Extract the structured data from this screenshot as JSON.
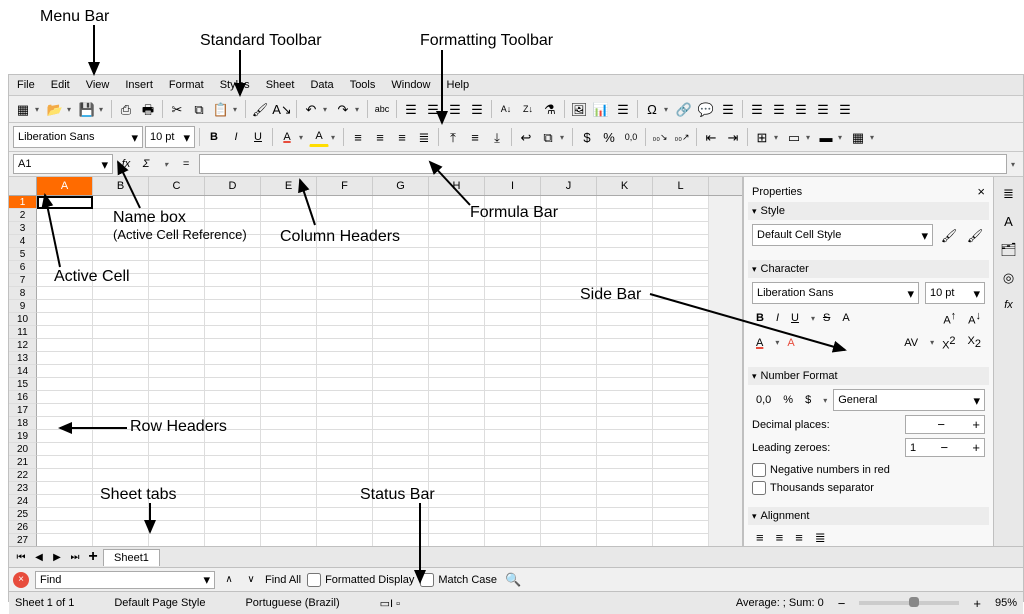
{
  "annotations": {
    "menu_bar": "Menu Bar",
    "standard_toolbar": "Standard Toolbar",
    "formatting_toolbar": "Formatting Toolbar",
    "name_box": "Name box",
    "name_box_sub": "(Active Cell Reference)",
    "active_cell": "Active Cell",
    "column_headers": "Column Headers",
    "formula_bar": "Formula Bar",
    "side_bar": "Side Bar",
    "row_headers": "Row Headers",
    "sheet_tabs": "Sheet tabs",
    "status_bar": "Status Bar"
  },
  "menu": [
    "File",
    "Edit",
    "View",
    "Insert",
    "Format",
    "Styles",
    "Sheet",
    "Data",
    "Tools",
    "Window",
    "Help"
  ],
  "formatting": {
    "font": "Liberation Sans",
    "size": "10 pt"
  },
  "name_box_value": "A1",
  "fx_label": "fx",
  "sigma": "Σ",
  "eq": "=",
  "columns": [
    "A",
    "B",
    "C",
    "D",
    "E",
    "F",
    "G",
    "H",
    "I",
    "J",
    "K",
    "L"
  ],
  "sidebar": {
    "panel_title": "Properties",
    "style_head": "Style",
    "style_value": "Default Cell Style",
    "character_head": "Character",
    "char_font": "Liberation Sans",
    "char_size": "10 pt",
    "number_format_head": "Number Format",
    "number_format_value": "General",
    "decimal_places_label": "Decimal places:",
    "leading_zeroes_label": "Leading zeroes:",
    "leading_zeroes_value": "1",
    "negative_red": "Negative numbers in red",
    "thousands_sep": "Thousands separator",
    "alignment_head": "Alignment"
  },
  "sheet_tab": "Sheet1",
  "find": {
    "label": "Find",
    "find_all": "Find All",
    "formatted": "Formatted Display",
    "match_case": "Match Case"
  },
  "status": {
    "sheet": "Sheet 1 of 1",
    "page_style": "Default Page Style",
    "locale": "Portuguese (Brazil)",
    "summary": "Average: ; Sum: 0",
    "zoom": "95%"
  },
  "icons": {
    "new": "▦",
    "open": "📂",
    "save": "💾",
    "export": "⎙",
    "print": "🖶",
    "cut": "✂",
    "copy": "⧉",
    "paste": "📋",
    "brush": "🖌",
    "undo": "↶",
    "redo": "↷",
    "spell": "abc",
    "sort_asc": "A↓",
    "sort_desc": "Z↓",
    "chart": "📊",
    "image": "🖼",
    "special": "Ω",
    "link": "🔗",
    "comment": "💬",
    "headers": "☰",
    "filter": "⚗",
    "bold": "B",
    "italic": "I",
    "underline": "U",
    "strike": "S",
    "font_color": "A",
    "highlight": "A",
    "align_l": "≡",
    "align_c": "≡",
    "align_r": "≡",
    "align_j": "≣",
    "wrap": "↩",
    "merge": "⧉",
    "valign_t": "⤒",
    "valign_m": "≡",
    "valign_b": "⤓",
    "currency": "$",
    "percent": "%",
    "number": "0,0",
    "dec_inc": "₀₀↗",
    "dec_dec": "₀₀↘",
    "indent_dec": "⇤",
    "indent_inc": "⇥",
    "borders": "⊞",
    "bordercolor": "▭",
    "bgcolor": "▬",
    "cond": "▦",
    "clear": "A↘",
    "dropdown": "▾",
    "close": "×",
    "minus": "−",
    "plus": "+",
    "tab_props": "≣",
    "tab_styles": "A",
    "tab_gallery": "🗂",
    "tab_nav": "◎",
    "tab_fn": "fx"
  }
}
